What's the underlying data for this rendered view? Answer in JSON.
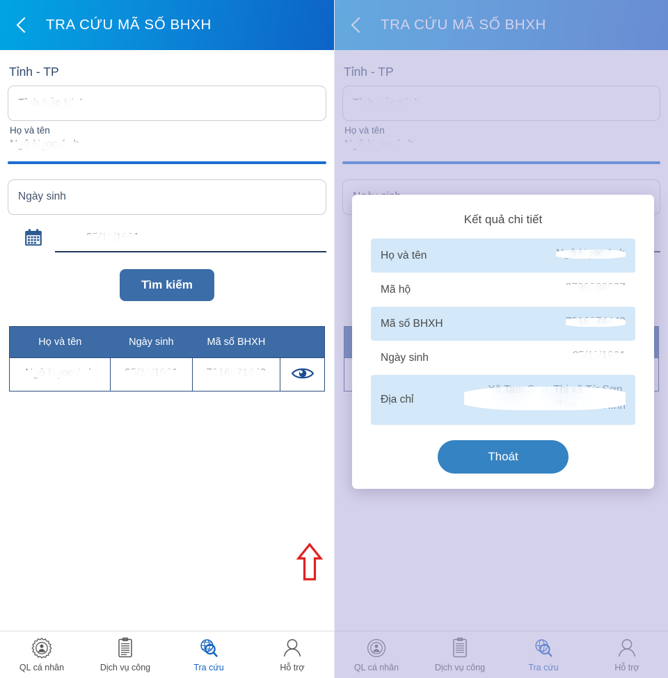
{
  "header": {
    "title": "TRA CỨU MÃ SỐ BHXH",
    "back_icon": "chevron-left-icon"
  },
  "form": {
    "province_label": "Tỉnh - TP",
    "province_value": "Tỉnh Bắc Ninh",
    "fullname_label": "Họ và tên",
    "fullname_value": "Ngô Ngọc Anh",
    "dob_placeholder": "Ngày sinh",
    "dob_value": "25/11/1991",
    "calendar_icon": "calendar-icon",
    "search_button": "Tìm kiếm"
  },
  "table": {
    "headers": [
      "Họ và tên",
      "Ngày sinh",
      "Mã số BHXH",
      ""
    ],
    "rows": [
      {
        "name": "Ngô Ngọc Anh",
        "dob": "25/11/1991",
        "code": "7016871449",
        "action_icon": "eye-icon"
      }
    ],
    "annotation_icon": "red-up-arrow-icon"
  },
  "tabbar": {
    "items": [
      {
        "label": "QL cá nhân",
        "icon": "gear-person-icon",
        "active": false
      },
      {
        "label": "Dịch vụ công",
        "icon": "document-icon",
        "active": false
      },
      {
        "label": "Tra cứu",
        "icon": "globe-search-icon",
        "active": true
      },
      {
        "label": "Hỗ trợ",
        "icon": "person-icon",
        "active": false
      }
    ]
  },
  "modal": {
    "title": "Kết quả chi tiết",
    "rows": [
      {
        "key": "Họ và tên",
        "value": "Ngô Ngọc Anh"
      },
      {
        "key": "Mã hộ",
        "value": "2799888887"
      },
      {
        "key": "Mã số BHXH",
        "value": "7916874449"
      },
      {
        "key": "Ngày sinh",
        "value": "25/11/1991"
      },
      {
        "key": "Địa chỉ",
        "value": "Xã Tam Sơn, Thị xã Từ Sơn, Tỉnh Bắc Ninh"
      }
    ],
    "exit_button": "Thoát"
  },
  "colors": {
    "header_gradient_start": "#00a5e3",
    "header_gradient_end": "#0d63c6",
    "primary_button": "#3b6da8",
    "table_header": "#3c6ba5",
    "modal_stripe": "#d3e8f8",
    "exit_button": "#3583c2",
    "accent_underline": "#1b6fcf",
    "annotation_red": "#e02020",
    "dim_overlay": "#b3addb"
  }
}
